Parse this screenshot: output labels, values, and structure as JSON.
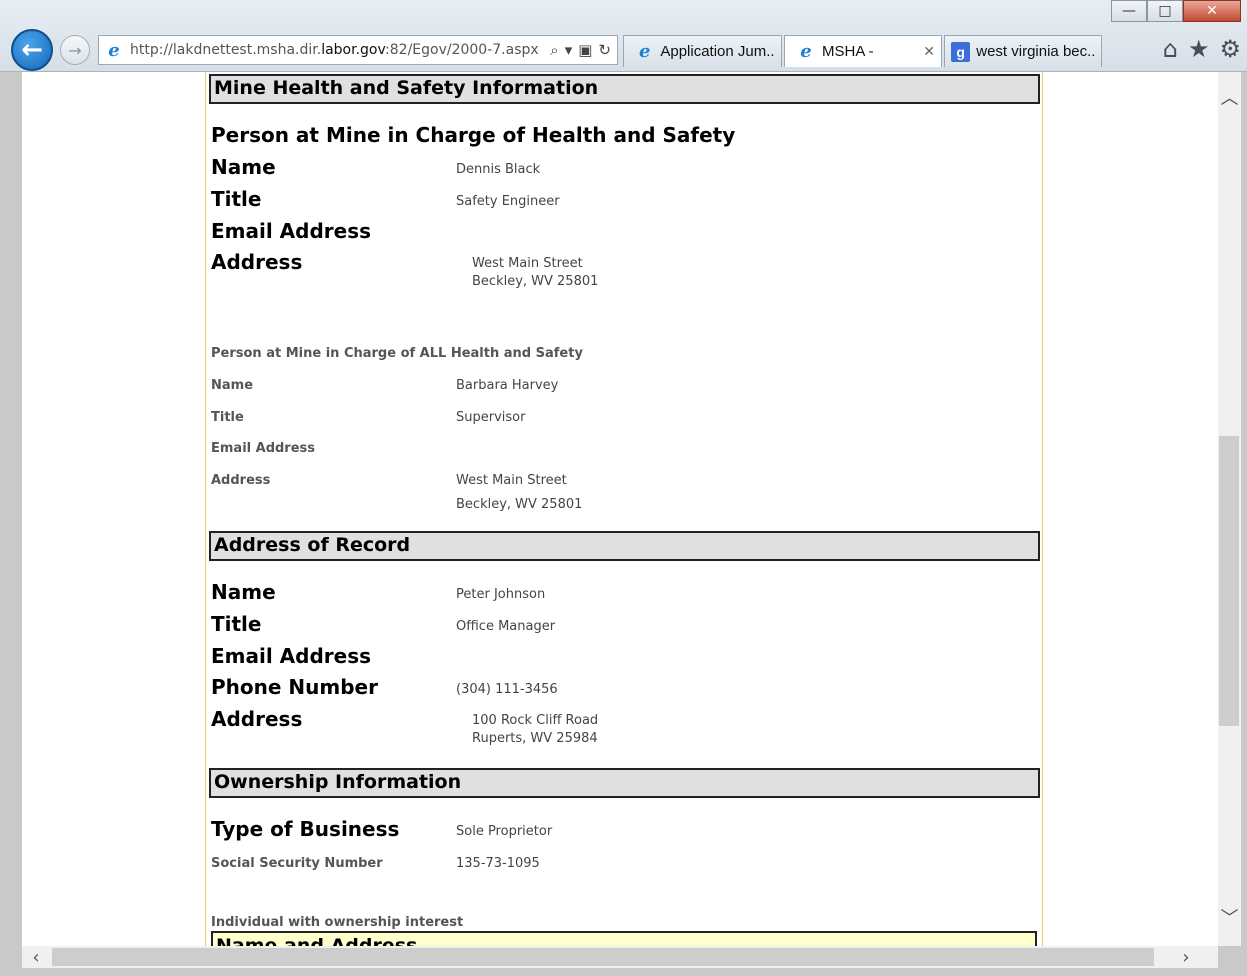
{
  "browser": {
    "url_prefix": "http://lakdnettest.msha.dir.",
    "url_domain": "labor.gov",
    "url_suffix": ":82/Egov/2000-7.aspx",
    "tabs": [
      {
        "label": "Application Jum..."
      },
      {
        "label": "MSHA -"
      },
      {
        "label": "west virginia bec..."
      }
    ],
    "window_controls": {
      "minimize": "—",
      "maximize": "□",
      "close": "✕"
    }
  },
  "sections": {
    "mine_health": {
      "header": "Mine Health and Safety Information",
      "person_in_charge": {
        "title": "Person at Mine in Charge of Health and Safety",
        "name_label": "Name",
        "name": "Dennis Black",
        "title_label": "Title",
        "job_title": "Safety Engineer",
        "email_label": "Email Address",
        "address_label": "Address",
        "address_line1": "West Main Street",
        "address_line2": "Beckley, WV 25801"
      },
      "person_all": {
        "title": "Person at Mine in Charge of ALL Health and Safety",
        "name_label": "Name",
        "name": "Barbara Harvey",
        "title_label": "Title",
        "job_title": "Supervisor",
        "email_label": "Email Address",
        "address_label": "Address",
        "address_line1": "West Main Street",
        "address_line2": "Beckley, WV 25801"
      }
    },
    "address_of_record": {
      "header": "Address of Record",
      "name_label": "Name",
      "name": "Peter Johnson",
      "title_label": "Title",
      "job_title": "Office Manager",
      "email_label": "Email Address",
      "phone_label": "Phone Number",
      "phone": "(304) 111-3456",
      "address_label": "Address",
      "address_line1": "100 Rock Cliff Road",
      "address_line2": "Ruperts, WV 25984"
    },
    "ownership": {
      "header": "Ownership Information",
      "business_type_label": "Type of Business",
      "business_type": "Sole Proprietor",
      "ssn_label": "Social Security Number",
      "ssn": "135-73-1095",
      "individual_label": "Individual with ownership interest",
      "name_address_header": "Name and Address"
    }
  }
}
